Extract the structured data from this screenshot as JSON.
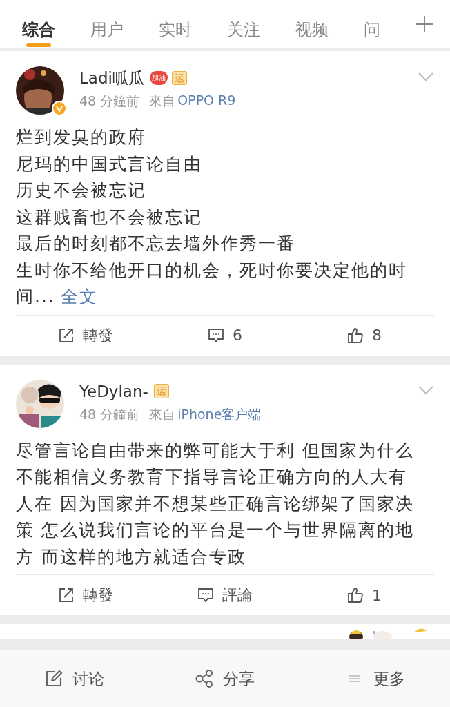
{
  "tabs": [
    {
      "label": "综合",
      "selected": true
    },
    {
      "label": "用户",
      "selected": false
    },
    {
      "label": "实时",
      "selected": false
    },
    {
      "label": "关注",
      "selected": false
    },
    {
      "label": "视频",
      "selected": false
    },
    {
      "label": "问",
      "selected": false
    }
  ],
  "posts": [
    {
      "name": "Ladi呱瓜",
      "verified": true,
      "badges": [
        {
          "kind": "heart",
          "text": "加油"
        },
        {
          "kind": "sport",
          "text": "运"
        }
      ],
      "time": "48 分鐘前",
      "from_label": "來自",
      "source": "OPPO R9",
      "lines": [
        "烂到发臭的政府",
        "尼玛的中国式言论自由",
        "历史不会被忘记",
        "这群贱畜也不会被忘记",
        "最后的时刻都不忘去墙外作秀一番",
        "生时你不给他开口的机会，死时你要决定他的时",
        "间..."
      ],
      "more_link": "全文",
      "actions": {
        "repost": "轉發",
        "comment": "6",
        "like": "8"
      }
    },
    {
      "name": "YeDylan-",
      "verified": false,
      "badges": [
        {
          "kind": "sport",
          "text": "运"
        }
      ],
      "time": "48 分鐘前",
      "from_label": "來自",
      "source": "iPhone客户端",
      "lines": [
        "尽管言论自由带来的弊可能大于利 但国家为什么",
        "不能相信义务教育下指导言论正确方向的人大有",
        "人在 因为国家并不想某些正确言论绑架了国家决",
        "策 怎么说我们言论的平台是一个与世界隔离的地",
        "方 而这样的地方就适合专政"
      ],
      "actions": {
        "repost": "轉發",
        "comment": "評論",
        "like": "1"
      }
    }
  ],
  "bottom_bar": [
    {
      "kind": "edit",
      "label": "讨论"
    },
    {
      "kind": "share",
      "label": "分享"
    },
    {
      "kind": "more",
      "label": "更多"
    }
  ]
}
